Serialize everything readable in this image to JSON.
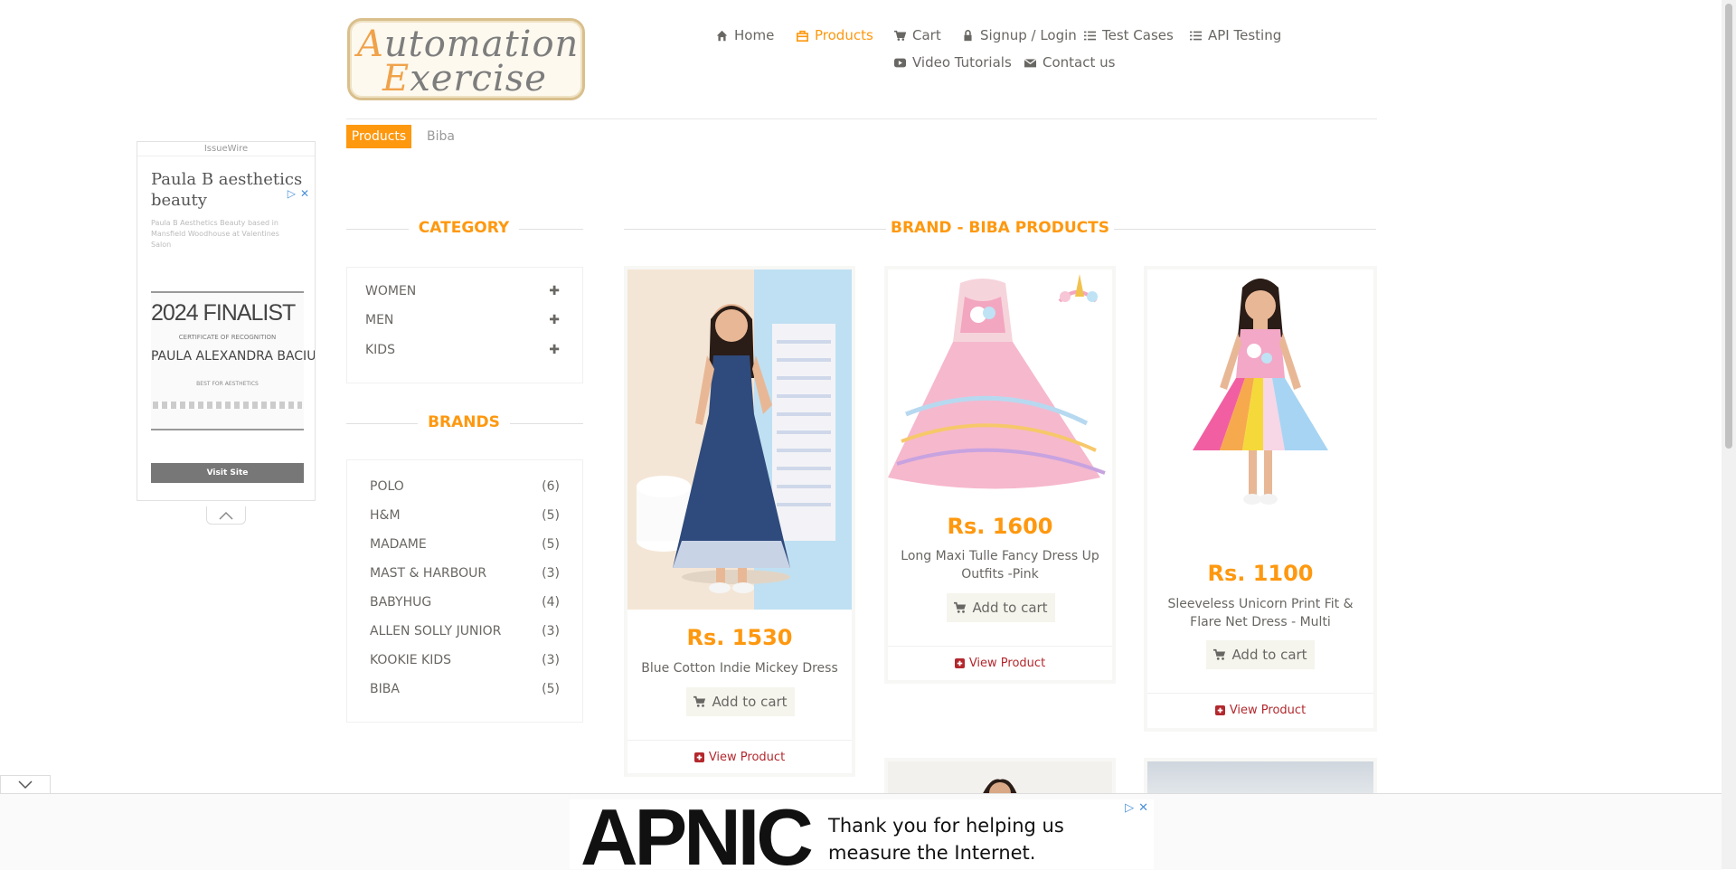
{
  "logo": {
    "line1_cap": "A",
    "line1_rest": "utomation",
    "line2_cap": "E",
    "line2_rest": "xercise"
  },
  "nav": {
    "home": "Home",
    "products": "Products",
    "cart": "Cart",
    "signup": "Signup / Login",
    "test_cases": "Test Cases",
    "api_testing": "API Testing",
    "video_tutorials": "Video Tutorials",
    "contact_us": "Contact us"
  },
  "breadcrumb": {
    "active": "Products",
    "current": "Biba"
  },
  "left_ad": {
    "source": "IssueWire",
    "headline": "Paula B aesthetics beauty",
    "body": "Paula B Aesthetics Beauty based in Mansfield Woodhouse at Valentines Salon",
    "cert_big": "2024 FINALIST",
    "cert_small": "CERTIFICATE OF RECOGNITION",
    "cert_name": "PAULA ALEXANDRA BACIU",
    "cert_best": "BEST FOR AESTHETICS",
    "visit_label": "Visit Site"
  },
  "category": {
    "title": "CATEGORY",
    "items": [
      {
        "label": "WOMEN"
      },
      {
        "label": "MEN"
      },
      {
        "label": "KIDS"
      }
    ]
  },
  "brands": {
    "title": "BRANDS",
    "items": [
      {
        "label": "POLO",
        "count": "(6)"
      },
      {
        "label": "H&M",
        "count": "(5)"
      },
      {
        "label": "MADAME",
        "count": "(5)"
      },
      {
        "label": "MAST & HARBOUR",
        "count": "(3)"
      },
      {
        "label": "BABYHUG",
        "count": "(4)"
      },
      {
        "label": "ALLEN SOLLY JUNIOR",
        "count": "(3)"
      },
      {
        "label": "KOOKIE KIDS",
        "count": "(3)"
      },
      {
        "label": "BIBA",
        "count": "(5)"
      }
    ]
  },
  "products": {
    "title": "BRAND - BIBA PRODUCTS",
    "add_to_cart": "Add to cart",
    "view_product": "View Product",
    "items": [
      {
        "price": "Rs. 1530",
        "name": "Blue Cotton Indie Mickey Dress"
      },
      {
        "price": "Rs. 1600",
        "name": "Long Maxi Tulle Fancy Dress Up Outfits -Pink"
      },
      {
        "price": "Rs. 1100",
        "name": "Sleeveless Unicorn Print Fit & Flare Net Dress - Multi"
      }
    ]
  },
  "bottom_ad": {
    "brand": "APNIC",
    "message": "Thank you for helping us measure the Internet."
  },
  "colors": {
    "accent": "#fe980f",
    "view_link": "#b3282d",
    "text": "#696763"
  }
}
